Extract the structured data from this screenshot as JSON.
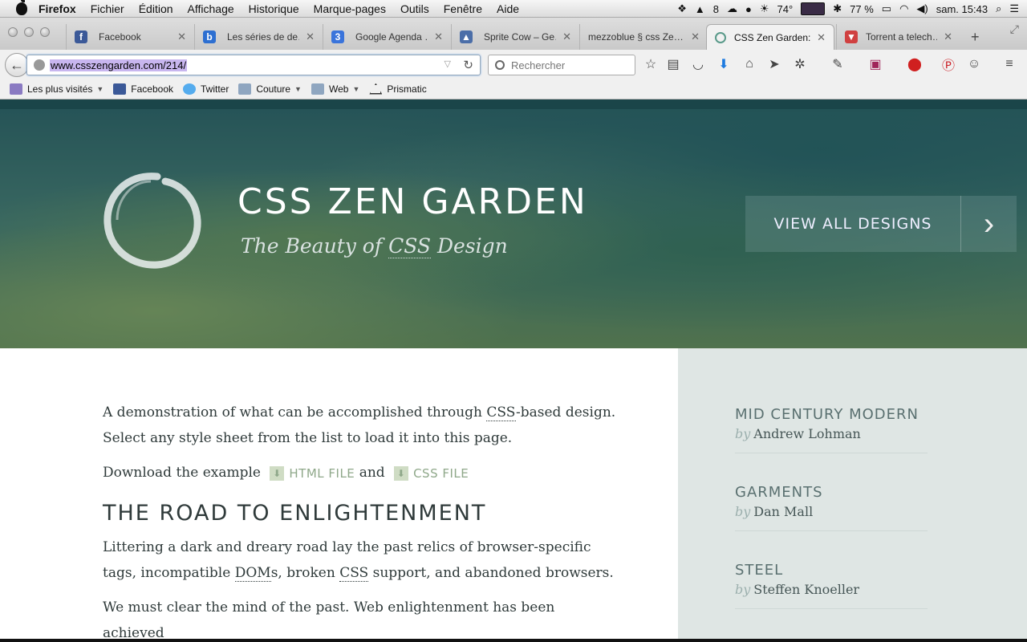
{
  "menubar": {
    "app": "Firefox",
    "items": [
      "Fichier",
      "Édition",
      "Affichage",
      "Historique",
      "Marque-pages",
      "Outils",
      "Fenêtre",
      "Aide"
    ],
    "status": {
      "adobe_count": "8",
      "temperature": "74°",
      "battery": "77 %",
      "clock": "sam. 15:43"
    }
  },
  "tabs": [
    {
      "title": "Facebook",
      "favicon": "facebook-icon",
      "color": "#3b5998"
    },
    {
      "title": "Les séries de de…",
      "favicon": "b-icon",
      "color": "#2d6fd1"
    },
    {
      "title": "Google Agenda …",
      "favicon": "calendar-icon",
      "color": "#3a74db"
    },
    {
      "title": "Sprite Cow – Ge…",
      "favicon": "image-icon",
      "color": "#4b6ea8"
    },
    {
      "title": "mezzoblue § css Ze…",
      "favicon": "",
      "color": ""
    },
    {
      "title": "CSS Zen Garden:…",
      "favicon": "circle-icon",
      "color": "#5a9a8a",
      "active": true
    },
    {
      "title": "Torrent a telech…",
      "favicon": "torrent-icon",
      "color": "#d04040"
    }
  ],
  "navbar": {
    "url": "www.csszengarden.com/214/",
    "search_placeholder": "Rechercher"
  },
  "bookmarks": [
    {
      "label": "Les plus visités",
      "icon": "folder-special-icon",
      "dropdown": true
    },
    {
      "label": "Facebook",
      "icon": "facebook-icon"
    },
    {
      "label": "Twitter",
      "icon": "twitter-icon"
    },
    {
      "label": "Couture",
      "icon": "folder-icon",
      "dropdown": true
    },
    {
      "label": "Web",
      "icon": "folder-icon",
      "dropdown": true
    },
    {
      "label": "Prismatic",
      "icon": "prismatic-icon"
    }
  ],
  "hero": {
    "title": "CSS ZEN GARDEN",
    "tagline_pre": "The Beauty of ",
    "tagline_abbr": "CSS",
    "tagline_post": " Design",
    "view_all": "VIEW ALL DESIGNS"
  },
  "main": {
    "intro_1": "A demonstration of what can be accomplished through ",
    "intro_abbr": "CSS",
    "intro_2": "-based design. Select any style sheet from the list to load it into this page.",
    "download_pre": "Download the example ",
    "html_file": "HTML FILE",
    "and": " and ",
    "css_file": "CSS FILE",
    "heading": "THE ROAD TO ENLIGHTENMENT",
    "p2_a": "Littering a dark and dreary road lay the past relics of browser-specific tags, incompatible ",
    "p2_abbr1": "DOM",
    "p2_b": "s, broken ",
    "p2_abbr2": "CSS",
    "p2_c": " support, and abandoned browsers.",
    "p3": "We must clear the mind of the past. Web enlightenment has been achieved"
  },
  "sidebar": {
    "by": "by",
    "designs": [
      {
        "name": "MID CENTURY MODERN",
        "author": "Andrew Lohman"
      },
      {
        "name": "GARMENTS",
        "author": "Dan Mall"
      },
      {
        "name": "STEEL",
        "author": "Steffen Knoeller"
      }
    ]
  },
  "colors": {
    "hero_teal": "#2e5a5a",
    "sidebar_bg": "#dfe6e4",
    "download_green": "#8fa88a"
  }
}
